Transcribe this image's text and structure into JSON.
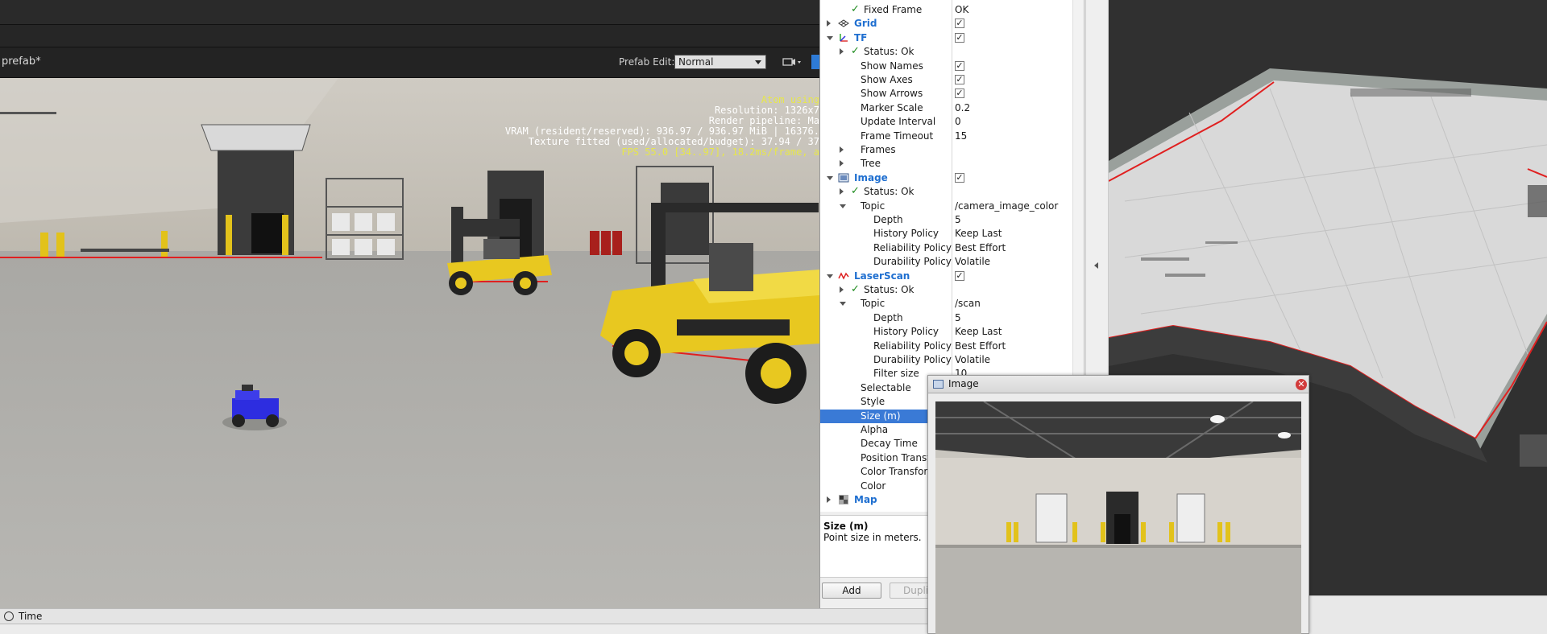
{
  "engine": {
    "tab_label": "prefab*",
    "prefab_edit_label": "Prefab Edit:",
    "prefab_edit_value": "Normal",
    "camera_button_icon": "camera-icon",
    "overlay_lines": [
      "Atom using",
      "Resolution: 1326x7",
      "Render pipeline: Ma",
      "VRAM (resident/reserved): 936.97 / 936.97 MiB | 16376.",
      "Texture fitted (used/allocated/budget): 37.94 / 37",
      "FPS 55.0 [34..97], 18.2ms/frame, a"
    ]
  },
  "displays": {
    "rows": [
      {
        "name": "Fixed Frame",
        "value": "OK",
        "indent": 1,
        "check": true,
        "expander": ""
      },
      {
        "name": "Grid",
        "value": "",
        "indent": 0,
        "category": true,
        "icon": "grid-icon",
        "checkbox": true,
        "expander": "right"
      },
      {
        "name": "TF",
        "value": "",
        "indent": 0,
        "category": true,
        "icon": "tf-icon",
        "checkbox": true,
        "expander": "down"
      },
      {
        "name": "Status: Ok",
        "value": "",
        "indent": 1,
        "check": true,
        "expander": "right"
      },
      {
        "name": "Show Names",
        "value": "",
        "indent": 1,
        "checkbox": true,
        "expander": ""
      },
      {
        "name": "Show Axes",
        "value": "",
        "indent": 1,
        "checkbox": true,
        "expander": ""
      },
      {
        "name": "Show Arrows",
        "value": "",
        "indent": 1,
        "checkbox": true,
        "expander": ""
      },
      {
        "name": "Marker Scale",
        "value": "0.2",
        "indent": 1,
        "expander": ""
      },
      {
        "name": "Update Interval",
        "value": "0",
        "indent": 1,
        "expander": ""
      },
      {
        "name": "Frame Timeout",
        "value": "15",
        "indent": 1,
        "expander": ""
      },
      {
        "name": "Frames",
        "value": "",
        "indent": 1,
        "expander": "right"
      },
      {
        "name": "Tree",
        "value": "",
        "indent": 1,
        "expander": "right"
      },
      {
        "name": "Image",
        "value": "",
        "indent": 0,
        "category": true,
        "icon": "image-icon",
        "checkbox": true,
        "expander": "down"
      },
      {
        "name": "Status: Ok",
        "value": "",
        "indent": 1,
        "check": true,
        "expander": "right"
      },
      {
        "name": "Topic",
        "value": "/camera_image_color",
        "indent": 1,
        "expander": "down"
      },
      {
        "name": "Depth",
        "value": "5",
        "indent": 2,
        "expander": ""
      },
      {
        "name": "History Policy",
        "value": "Keep Last",
        "indent": 2,
        "expander": ""
      },
      {
        "name": "Reliability Policy",
        "value": "Best Effort",
        "indent": 2,
        "expander": ""
      },
      {
        "name": "Durability Policy",
        "value": "Volatile",
        "indent": 2,
        "expander": ""
      },
      {
        "name": "LaserScan",
        "value": "",
        "indent": 0,
        "category": true,
        "icon": "laserscan-icon",
        "checkbox": true,
        "expander": "down"
      },
      {
        "name": "Status: Ok",
        "value": "",
        "indent": 1,
        "check": true,
        "expander": "right"
      },
      {
        "name": "Topic",
        "value": "/scan",
        "indent": 1,
        "expander": "down"
      },
      {
        "name": "Depth",
        "value": "5",
        "indent": 2,
        "expander": ""
      },
      {
        "name": "History Policy",
        "value": "Keep Last",
        "indent": 2,
        "expander": ""
      },
      {
        "name": "Reliability Policy",
        "value": "Best Effort",
        "indent": 2,
        "expander": ""
      },
      {
        "name": "Durability Policy",
        "value": "Volatile",
        "indent": 2,
        "expander": ""
      },
      {
        "name": "Filter size",
        "value": "10",
        "indent": 2,
        "expander": ""
      },
      {
        "name": "Selectable",
        "value": "",
        "indent": 1,
        "expander": ""
      },
      {
        "name": "Style",
        "value": "",
        "indent": 1,
        "expander": ""
      },
      {
        "name": "Size (m)",
        "value": "",
        "indent": 1,
        "expander": "",
        "selected": true
      },
      {
        "name": "Alpha",
        "value": "",
        "indent": 1,
        "expander": ""
      },
      {
        "name": "Decay Time",
        "value": "",
        "indent": 1,
        "expander": ""
      },
      {
        "name": "Position Transfor",
        "value": "",
        "indent": 1,
        "expander": ""
      },
      {
        "name": "Color Transformer",
        "value": "",
        "indent": 1,
        "expander": ""
      },
      {
        "name": "Color",
        "value": "",
        "indent": 1,
        "expander": ""
      },
      {
        "name": "Map",
        "value": "",
        "indent": 0,
        "category": true,
        "icon": "map-icon",
        "expander": "right"
      }
    ],
    "help_title": "Size (m)",
    "help_text": "Point size in meters.",
    "add_button": "Add",
    "duplicate_button": "Duplicate",
    "time_label": "Time"
  },
  "image_window": {
    "title": "Image",
    "close_icon": "close-icon"
  },
  "colors": {
    "accent": "#3a7ad6",
    "category_text": "#1f6fd0",
    "check_green": "#1e8b1e",
    "robot_blue": "#2d2de0",
    "forklift_yellow": "#e8c820",
    "scan_red": "#e02020"
  }
}
